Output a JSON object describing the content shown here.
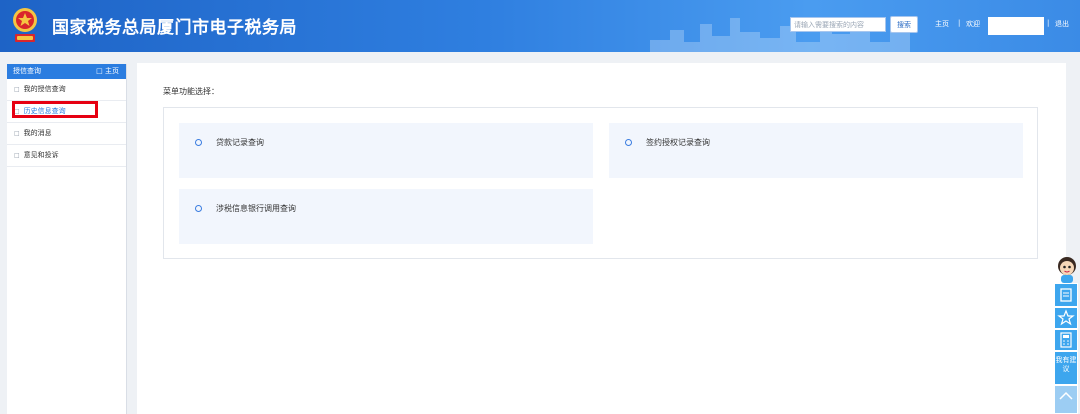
{
  "header": {
    "site_title": "国家税务总局厦门市电子税务局",
    "search_placeholder": "请输入需要搜索的内容",
    "search_button": "搜索",
    "home_link": "主页",
    "divider": "|",
    "welcome_label": "欢迎",
    "logout_link": "退出"
  },
  "sidebar": {
    "header_label": "授信查询",
    "home_label": "主页",
    "items": [
      {
        "label": "我的授信查询"
      },
      {
        "label": "历史信息查询",
        "active": true
      },
      {
        "label": "我的消息"
      },
      {
        "label": "意见和投诉"
      }
    ]
  },
  "main": {
    "menu_label": "菜单功能选择：",
    "options": [
      {
        "label": "贷款记录查询"
      },
      {
        "label": "签约授权记录查询"
      },
      {
        "label": "涉税信息银行调用查询"
      }
    ]
  },
  "float_tools": {
    "suggest_label": "我有建议"
  },
  "colors": {
    "header_blue": "#2f7fe0",
    "accent_blue": "#2b7de0",
    "highlight_red": "#e60012",
    "card_bg": "#f2f6fd",
    "tool_blue": "#3da6ee"
  },
  "icons": [
    "emblem-icon",
    "mascot-icon",
    "chat-icon",
    "star-icon",
    "calculator-icon",
    "arrow-up-icon"
  ]
}
